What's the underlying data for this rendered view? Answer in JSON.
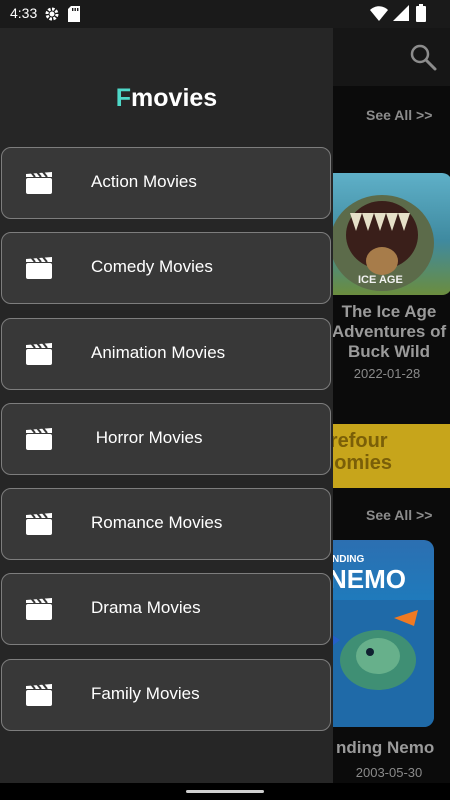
{
  "status_bar": {
    "time": "4:33"
  },
  "app": {
    "sections": [
      {
        "see_all": "See All >>"
      },
      {
        "see_all": "See All >>"
      }
    ],
    "movies": [
      {
        "title": "The Ice Age Adventures of Buck Wild",
        "date": "2022-01-28"
      },
      {
        "title": "nding Nemo",
        "date": "2003-05-30"
      }
    ],
    "ad_text": "rrefour\nnomies"
  },
  "drawer": {
    "brand_first": "F",
    "brand_rest": "movies",
    "items": [
      {
        "label": "Action Movies",
        "icon": "clapperboard-icon"
      },
      {
        "label": "Comedy Movies",
        "icon": "clapperboard-icon"
      },
      {
        "label": "Animation Movies",
        "icon": "clapperboard-icon"
      },
      {
        "label": " Horror Movies",
        "icon": "clapperboard-icon"
      },
      {
        "label": "Romance Movies",
        "icon": "clapperboard-icon"
      },
      {
        "label": "Drama Movies",
        "icon": "clapperboard-icon"
      },
      {
        "label": "Family Movies",
        "icon": "clapperboard-icon"
      }
    ]
  },
  "colors": {
    "accent": "#4ed8c8",
    "drawer_bg": "#262626",
    "item_bg": "#383838"
  }
}
